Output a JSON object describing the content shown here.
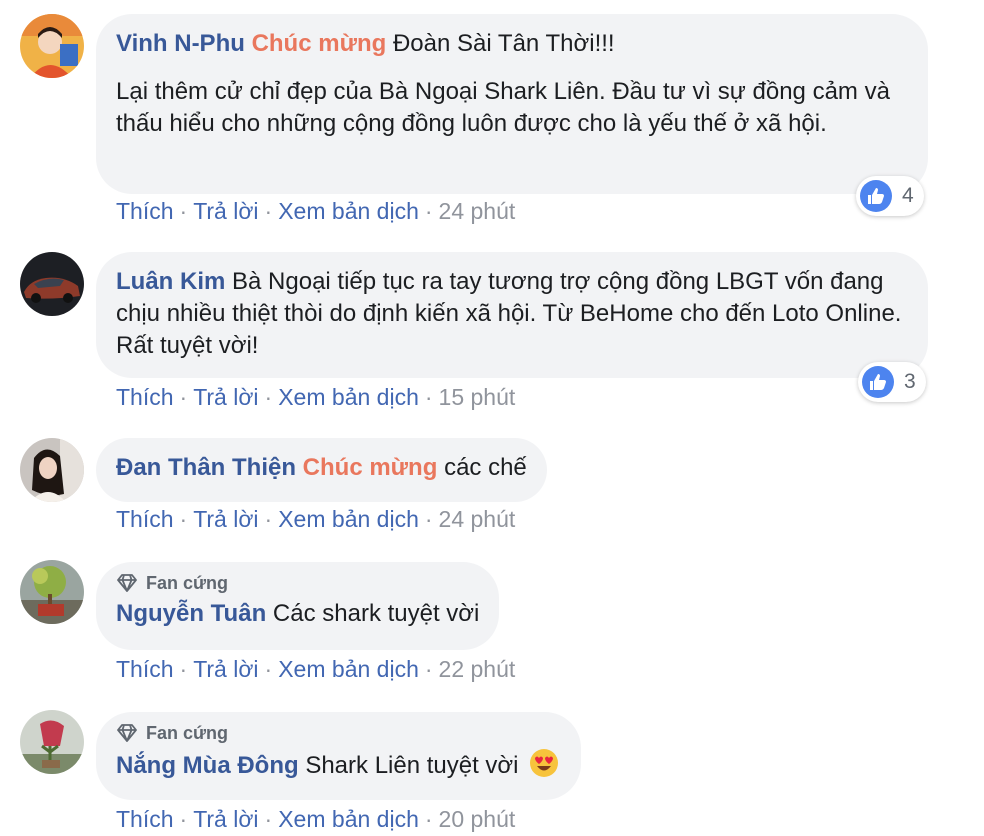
{
  "comments": [
    {
      "author": "Vinh N-Phu",
      "tag": "Chúc mừng",
      "text": "Đoàn Sài Tân Thời!!!",
      "paragraph": "Lại thêm cử chỉ đẹp của Bà Ngoại Shark Liên. Đầu tư vì sự đồng cảm và thấu hiểu cho những cộng đồng luôn được cho là yếu thế ở xã hội.",
      "like_count": "4",
      "time": "24 phút"
    },
    {
      "author": "Luân Kim",
      "text": "Bà Ngoại tiếp tục ra tay tương trợ cộng đồng LBGT vốn đang chịu nhiều thiệt thòi do định kiến xã hội. Từ BeHome cho đến Loto Online. Rất tuyệt vời!",
      "like_count": "3",
      "time": "15 phút"
    },
    {
      "author": "Đan Thân Thiện",
      "tag": "Chúc mừng",
      "text": "các chế",
      "time": "24 phút"
    },
    {
      "badge": "Fan cứng",
      "author": "Nguyễn Tuân",
      "text": "Các shark tuyệt vời",
      "time": "22 phút"
    },
    {
      "badge": "Fan cứng",
      "author": "Nắng Mùa Đông",
      "text": "Shark Liên tuyệt vời",
      "emoji": "heart-eyes-emoji",
      "time": "20 phút"
    }
  ],
  "actions": {
    "like": "Thích",
    "reply": "Trả lời",
    "translate": "Xem bản dịch"
  },
  "icons": {
    "like": "like-icon",
    "badge": "diamond-icon"
  },
  "colors": {
    "name": "#385898",
    "tag": "#e9775d",
    "link": "#4267b2",
    "bubble": "#f2f3f5",
    "meta": "#90949c",
    "like_blue": "#4d84ef"
  }
}
